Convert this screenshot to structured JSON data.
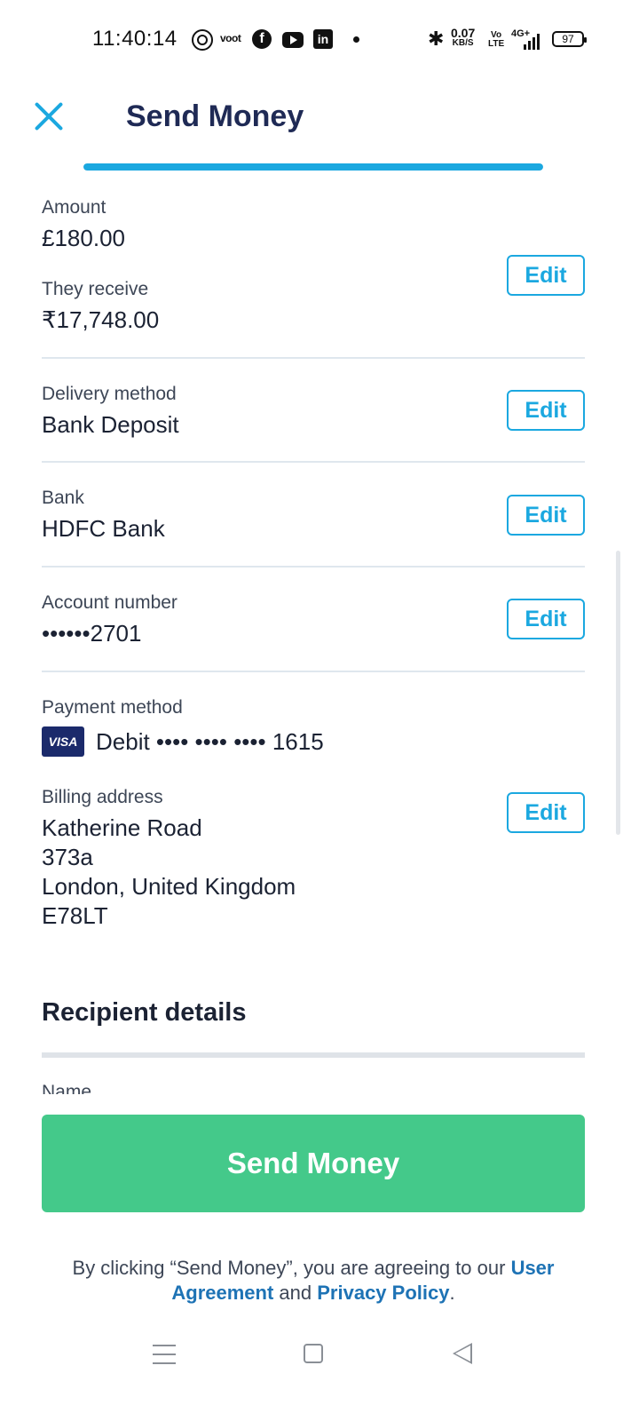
{
  "status_bar": {
    "time": "11:40:14",
    "voot_label": "voot",
    "network_speed": "0.07",
    "network_speed_unit": "KB/S",
    "volte_top": "Vo",
    "volte_bottom": "LTE",
    "network_type": "4G+",
    "battery": "97"
  },
  "header": {
    "title": "Send Money",
    "progress_fraction": 1.0
  },
  "summary": {
    "amount_label": "Amount",
    "amount_value": "£180.00",
    "receive_label": "They receive",
    "receive_value": "₹17,748.00",
    "delivery_label": "Delivery method",
    "delivery_value": "Bank Deposit",
    "bank_label": "Bank",
    "bank_value": "HDFC Bank",
    "account_label": "Account number",
    "account_value": "••••••2701",
    "payment_label": "Payment method",
    "payment_card_brand": "VISA",
    "payment_value": "Debit •••• •••• •••• 1615",
    "billing_label": "Billing address",
    "billing_line1": "Katherine Road",
    "billing_line2": "373a",
    "billing_line3": "London, United Kingdom",
    "billing_line4": "E78LT",
    "edit_label": "Edit"
  },
  "recipient": {
    "section_title": "Recipient details",
    "name_label": "Name"
  },
  "footer": {
    "send_button_label": "Send Money",
    "agreement_prefix": "By clicking “Send Money”, you are agreeing to our ",
    "user_agreement_link": "User Agreement",
    "agreement_middle": " and ",
    "privacy_policy_link": "Privacy Policy",
    "agreement_suffix": "."
  },
  "colors": {
    "accent": "#1ba8e0",
    "title": "#1f2a55",
    "send_button": "#44c98a",
    "link": "#1e73b5",
    "visa_badge": "#1b2a6b"
  },
  "icons": {
    "close": "close-icon",
    "whatsapp": "whatsapp-icon",
    "facebook": "facebook-icon",
    "youtube": "youtube-icon",
    "linkedin": "linkedin-icon",
    "bluetooth": "bluetooth-icon",
    "signal": "signal-icon",
    "battery": "battery-icon",
    "nav_menu": "menu-icon",
    "nav_home": "home-icon",
    "nav_back": "back-icon"
  }
}
